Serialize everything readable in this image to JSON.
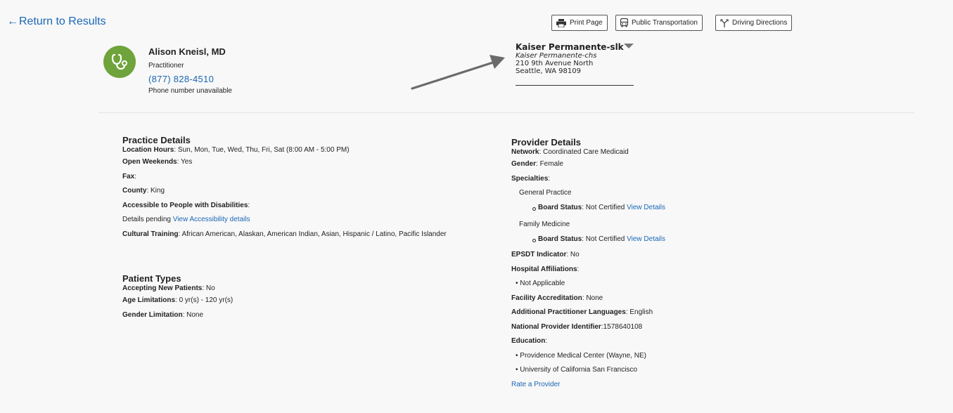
{
  "nav": {
    "return_label": "Return to Results",
    "return_arrow": "←"
  },
  "toolbar": {
    "print_label": "Print Page",
    "transit_label": "Public Transportation",
    "directions_label": "Driving Directions"
  },
  "provider": {
    "name": "Alison Kneisl, MD",
    "role": "Practitioner",
    "phone": "(877) 828-4510",
    "phone_note": "Phone number unavailable",
    "avatar_icon": "stethoscope-icon",
    "avatar_color": "#6fa33c"
  },
  "location": {
    "name": "Kaiser Permanente-slk",
    "subname": "Kaiser Permanente-chs",
    "address1": "210 9th Avenue North",
    "address2": "Seattle, WA 98109"
  },
  "practice": {
    "title": "Practice Details",
    "hours_label": "Location Hours",
    "hours_value": ": Sun, Mon, Tue, Wed, Thu, Fri, Sat (8:00 AM - 5:00 PM)",
    "weekends_label": "Open Weekends",
    "weekends_value": ": Yes",
    "fax_label": "Fax",
    "fax_value": ":",
    "county_label": "County",
    "county_value": ": King",
    "access_label": "Accessible to People with Disabilities",
    "access_value": ":",
    "access_pending": "Details pending ",
    "access_link": "View Accessibility details",
    "cultural_label": "Cultural Training",
    "cultural_value": ": African American, Alaskan, American Indian, Asian, Hispanic / Latino, Pacific Islander"
  },
  "patient_types": {
    "title": "Patient Types",
    "accepting_label": "Accepting New Patients",
    "accepting_value": ": No",
    "age_label": "Age Limitations",
    "age_value": ": 0 yr(s) - 120 yr(s)",
    "gender_label": "Gender Limitation",
    "gender_value": ": None"
  },
  "provider_details": {
    "title": "Provider Details",
    "network_label": "Network",
    "network_value": ": Coordinated Care Medicaid",
    "gender_label": "Gender",
    "gender_value": ": Female",
    "specialties_label": "Specialties",
    "specialties_value": ":",
    "specialties": [
      {
        "name": "General Practice",
        "board_label": "Board Status",
        "board_value": ": Not Certified ",
        "link": "View Details"
      },
      {
        "name": "Family Medicine",
        "board_label": "Board Status",
        "board_value": ": Not Certified ",
        "link": "View Details"
      }
    ],
    "epsdt_label": "EPSDT Indicator",
    "epsdt_value": ": No",
    "hospital_label": "Hospital Affiliations",
    "hospital_value": ":",
    "hospital_items": [
      "• Not Applicable"
    ],
    "facility_label": "Facility Accreditation",
    "facility_value": ": None",
    "languages_label": "Additional Practitioner Languages",
    "languages_value": ": English",
    "npi_label": "National Provider Identifier",
    "npi_value": ":1578640108",
    "education_label": "Education",
    "education_value": ":",
    "education_items": [
      "• Providence Medical Center (Wayne, NE)",
      "• University of California San Francisco"
    ],
    "rate_link": "Rate a Provider"
  }
}
